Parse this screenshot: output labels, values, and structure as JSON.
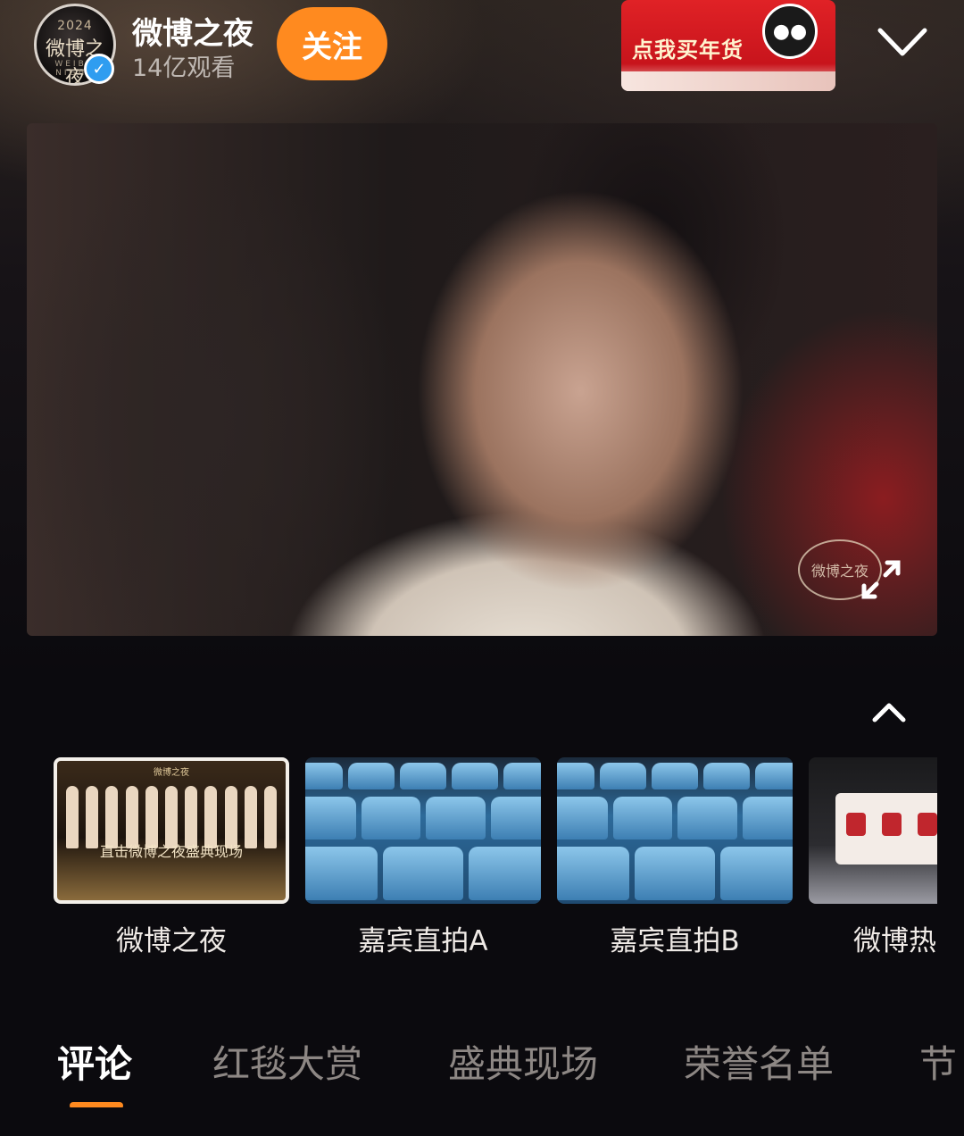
{
  "header": {
    "account_name": "微博之夜",
    "views": "14亿观看",
    "follow_label": "关注",
    "avatar": {
      "year": "2024",
      "title": "微博之夜",
      "subtitle": "WEIBO NIGHT"
    },
    "ad_banner": {
      "text": "点我买年货"
    }
  },
  "video": {
    "watermark": "微博之夜"
  },
  "channels": [
    {
      "label": "微博之夜",
      "active": true,
      "thumb_text": "直击微博之夜盛典现场"
    },
    {
      "label": "嘉宾直拍A",
      "active": false
    },
    {
      "label": "嘉宾直拍B",
      "active": false
    },
    {
      "label": "微博热",
      "active": false
    }
  ],
  "tabs": [
    {
      "label": "评论",
      "active": true
    },
    {
      "label": "红毯大赏",
      "active": false
    },
    {
      "label": "盛典现场",
      "active": false
    },
    {
      "label": "荣誉名单",
      "active": false
    },
    {
      "label": "节",
      "active": false
    }
  ],
  "colors": {
    "accent": "#ff8a1f",
    "verified": "#2f9df0",
    "background": "#0b0a0e"
  },
  "icons": {
    "collapse": "chevron-down-icon",
    "expand": "chevron-up-icon",
    "fullscreen": "fullscreen-icon",
    "verified": "verified-badge-icon"
  }
}
